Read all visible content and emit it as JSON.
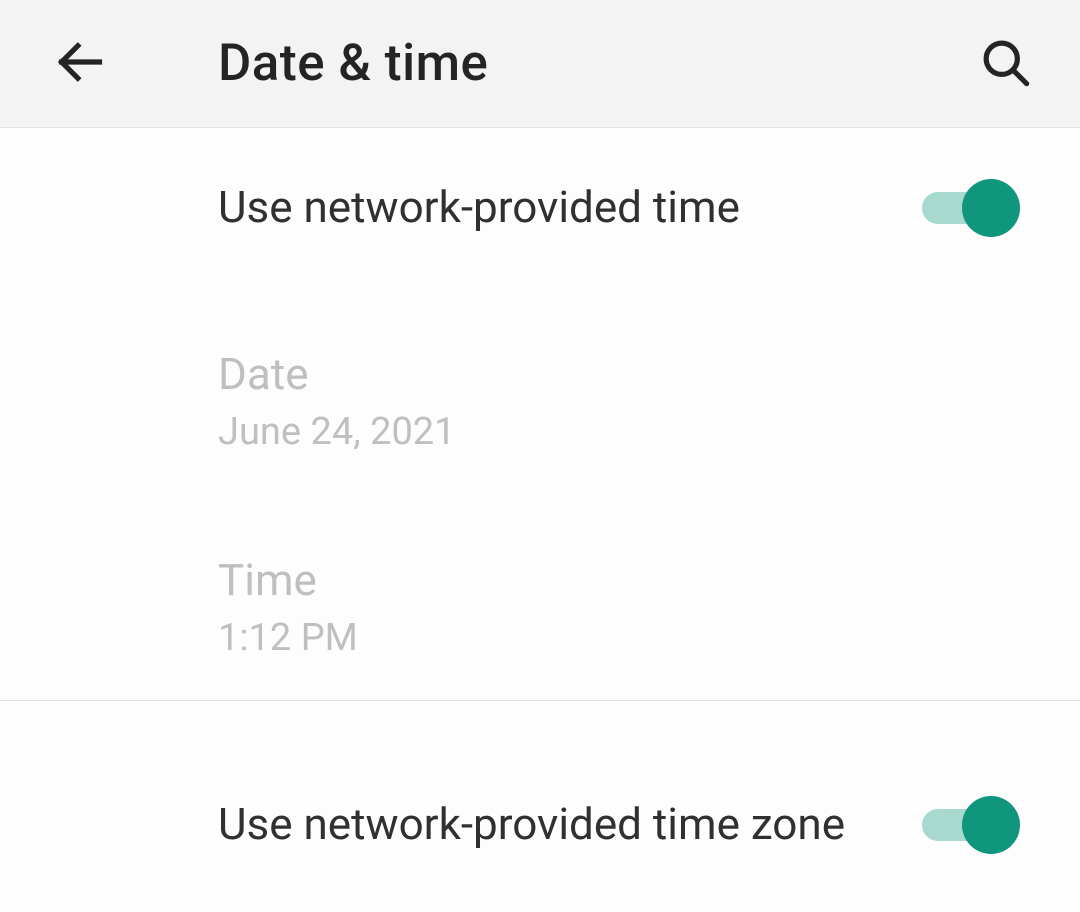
{
  "header": {
    "title": "Date & time"
  },
  "settings": {
    "network_time": {
      "label": "Use network-provided time",
      "enabled": true
    },
    "date": {
      "label": "Date",
      "value": "June 24, 2021"
    },
    "time": {
      "label": "Time",
      "value": "1:12 PM"
    },
    "network_timezone": {
      "label": "Use network-provided time zone",
      "enabled": true
    }
  },
  "colors": {
    "accent": "#0f967d",
    "accent_light": "#a7d9cf"
  }
}
